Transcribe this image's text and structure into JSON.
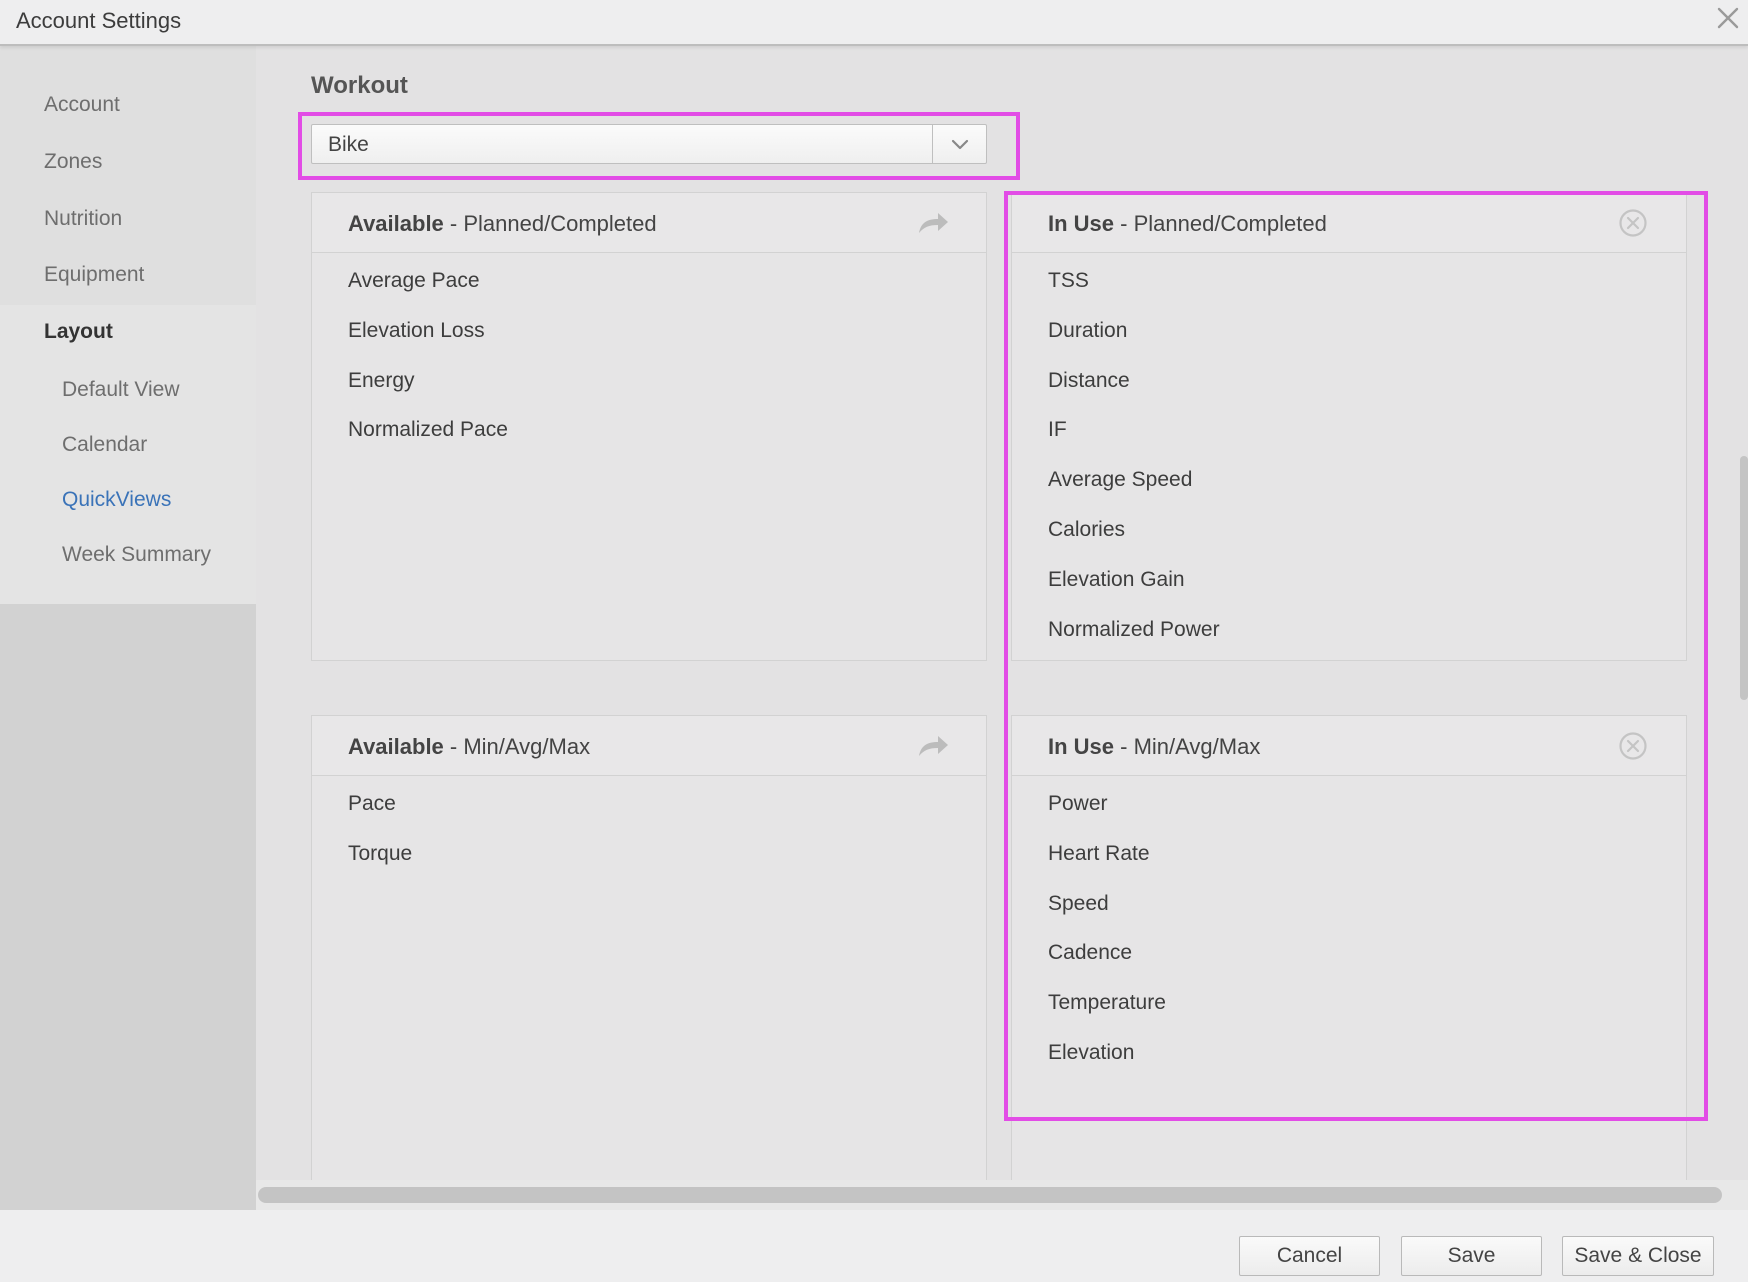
{
  "window": {
    "title": "Account Settings",
    "close_icon": "close-icon"
  },
  "sidebar": {
    "items": [
      {
        "label": "Account"
      },
      {
        "label": "Zones"
      },
      {
        "label": "Nutrition"
      },
      {
        "label": "Equipment"
      },
      {
        "label": "Layout"
      },
      {
        "label": "Default View"
      },
      {
        "label": "Calendar"
      },
      {
        "label": "QuickViews"
      },
      {
        "label": "Week Summary"
      }
    ],
    "active_color": "#3a73b8"
  },
  "main": {
    "section_title": "Workout",
    "workout_select": {
      "value": "Bike",
      "icon": "chevron-down-icon"
    },
    "panels": {
      "available_planned": {
        "title_bold": "Available",
        "title_rest": " - Planned/Completed",
        "action_icon": "share-arrow-icon",
        "items": [
          "Average Pace",
          "Elevation Loss",
          "Energy",
          "Normalized Pace"
        ]
      },
      "inuse_planned": {
        "title_bold": "In Use",
        "title_rest": " - Planned/Completed",
        "action_icon": "remove-circle-icon",
        "items": [
          "TSS",
          "Duration",
          "Distance",
          "IF",
          "Average Speed",
          "Calories",
          "Elevation Gain",
          "Normalized Power"
        ]
      },
      "available_minavgmax": {
        "title_bold": "Available",
        "title_rest": " - Min/Avg/Max",
        "action_icon": "share-arrow-icon",
        "items": [
          "Pace",
          "Torque"
        ]
      },
      "inuse_minavgmax": {
        "title_bold": "In Use",
        "title_rest": " - Min/Avg/Max",
        "action_icon": "remove-circle-icon",
        "items": [
          "Power",
          "Heart Rate",
          "Speed",
          "Cadence",
          "Temperature",
          "Elevation"
        ]
      }
    },
    "highlight_color": "#e24ce6"
  },
  "footer": {
    "cancel_label": "Cancel",
    "save_label": "Save",
    "save_close_label": "Save & Close"
  }
}
